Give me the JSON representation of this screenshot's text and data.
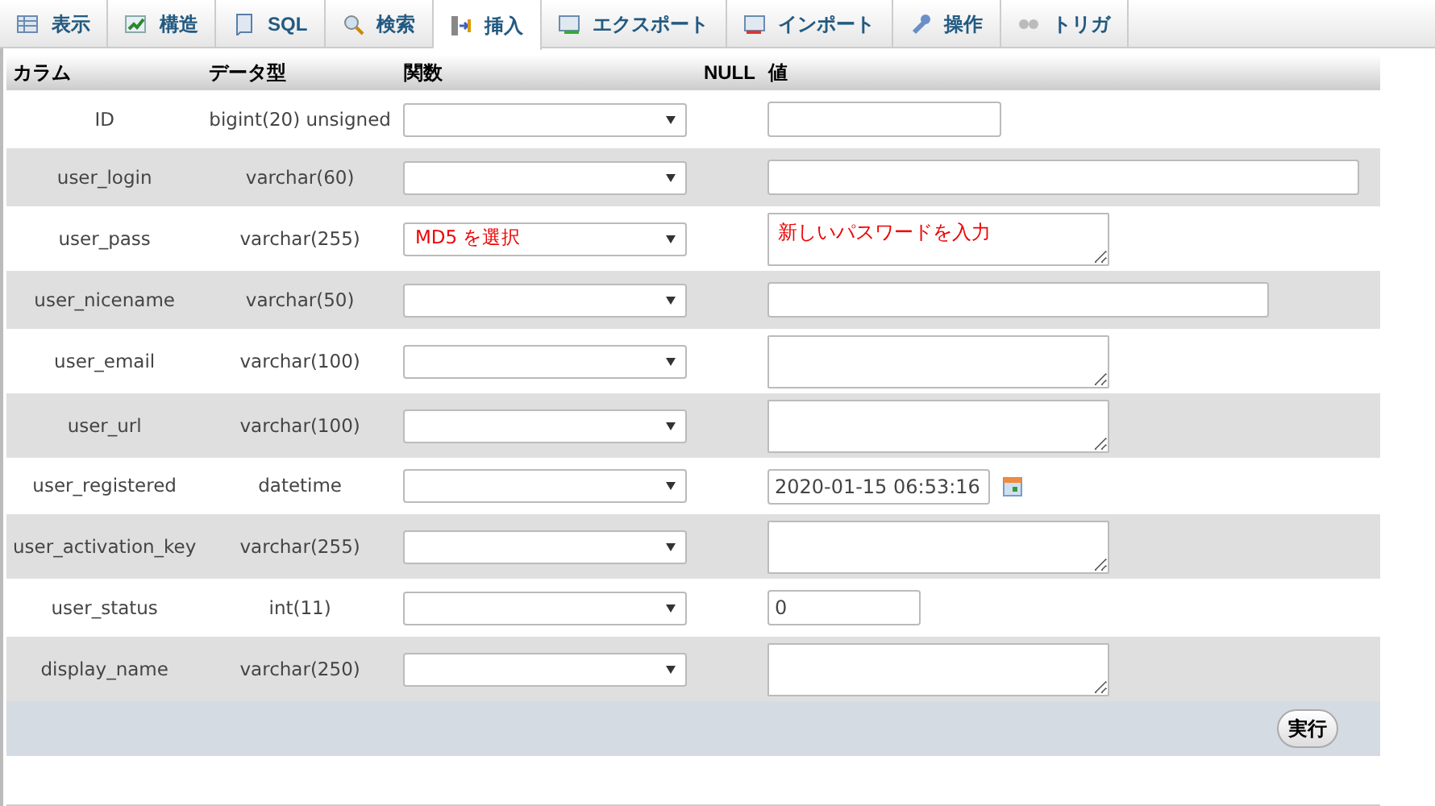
{
  "tabs": [
    {
      "label": "表示",
      "selected": false
    },
    {
      "label": "構造",
      "selected": false
    },
    {
      "label": "SQL",
      "selected": false
    },
    {
      "label": "検索",
      "selected": false
    },
    {
      "label": "挿入",
      "selected": true
    },
    {
      "label": "エクスポート",
      "selected": false
    },
    {
      "label": "インポート",
      "selected": false
    },
    {
      "label": "操作",
      "selected": false
    },
    {
      "label": "トリガ",
      "selected": false
    }
  ],
  "columns": [
    "カラム",
    "データ型",
    "関数",
    "NULL",
    "値"
  ],
  "rows": [
    {
      "column": "ID",
      "type": "bigint(20) unsigned",
      "kind": "short-input"
    },
    {
      "column": "user_login",
      "type": "varchar(60)",
      "kind": "wide-input"
    },
    {
      "column": "user_pass",
      "type": "varchar(255)",
      "kind": "textarea",
      "function": "MD5 を選択",
      "value": "新しいパスワードを入力"
    },
    {
      "column": "user_nicename",
      "type": "varchar(50)",
      "kind": "medium-input"
    },
    {
      "column": "user_email",
      "type": "varchar(100)",
      "kind": "textarea"
    },
    {
      "column": "user_url",
      "type": "varchar(100)",
      "kind": "textarea"
    },
    {
      "column": "user_registered",
      "type": "datetime",
      "kind": "datetime",
      "value": "2020-01-15 06:53:16"
    },
    {
      "column": "user_activation_key",
      "type": "varchar(255)",
      "kind": "textarea"
    },
    {
      "column": "user_status",
      "type": "int(11)",
      "kind": "number-input",
      "value": "0"
    },
    {
      "column": "display_name",
      "type": "varchar(250)",
      "kind": "textarea"
    }
  ],
  "submit": "実行"
}
